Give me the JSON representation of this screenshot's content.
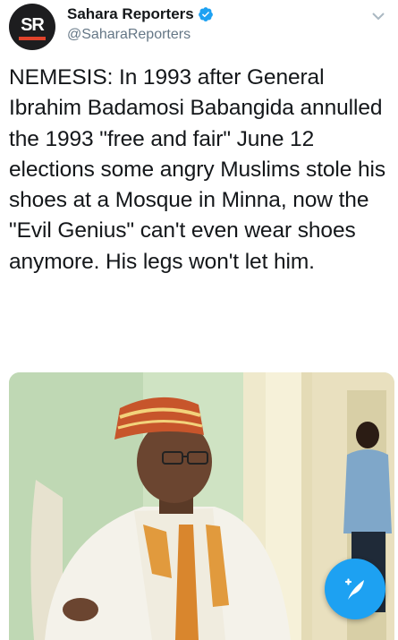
{
  "tweet": {
    "avatar_initials": "SR",
    "display_name": "Sahara Reporters",
    "handle": "@SaharaReporters",
    "text": "NEMESIS: In 1993 after General Ibrahim Badamosi Babangida annulled the 1993 \"free and fair\" June 12 elections some angry Muslims stole his shoes at a Mosque in Minna, now the \"Evil Genius\" can't even wear shoes anymore. His legs won't let him."
  },
  "icons": {
    "verified": "verified-badge-icon",
    "menu": "chevron-down-icon",
    "compose": "compose-tweet-icon"
  },
  "colors": {
    "accent": "#1da1f2",
    "brand_red": "#e0432b",
    "avatar_bg": "#1d1d1f",
    "handle_gray": "#657786"
  }
}
